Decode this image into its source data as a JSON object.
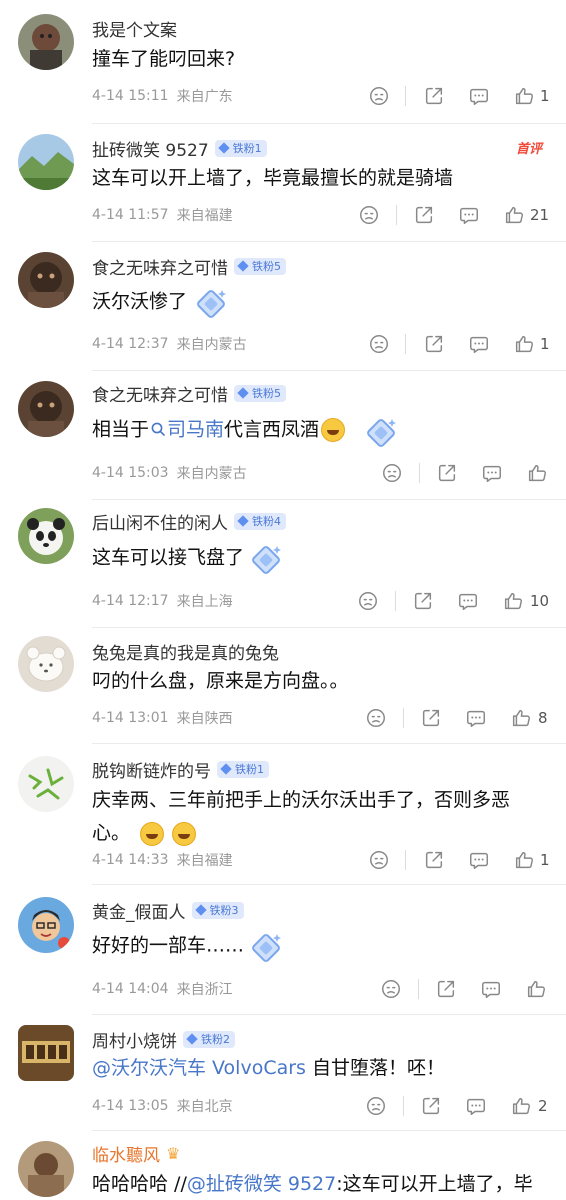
{
  "comments": [
    {
      "user": "我是个文案",
      "text": "撞车了能叼回来?",
      "time": "4-14 15:11",
      "location": "来自广东",
      "likes": "1"
    },
    {
      "user": "扯砖微笑 9527",
      "badge": "铁粉1",
      "hot": "首评",
      "text": "这车可以开上墙了，毕竟最擅长的就是骑墙",
      "time": "4-14 11:57",
      "location": "来自福建",
      "likes": "21"
    },
    {
      "user": "食之无味弃之可惜",
      "badge": "铁粉5",
      "text": "沃尔沃惨了",
      "time": "4-14 12:37",
      "location": "来自内蒙古",
      "likes": "1"
    },
    {
      "user": "食之无味弃之可惜",
      "badge": "铁粉5",
      "text_pre": "相当于",
      "text_link": "司马南",
      "text_post": "代言西凤酒",
      "time": "4-14 15:03",
      "location": "来自内蒙古",
      "likes": ""
    },
    {
      "user": "后山闲不住的闲人",
      "badge": "铁粉4",
      "text": "这车可以接飞盘了",
      "time": "4-14 12:17",
      "location": "来自上海",
      "likes": "10"
    },
    {
      "user": "兔兔是真的我是真的兔兔",
      "text": "叼的什么盘，原来是方向盘。。",
      "time": "4-14 13:01",
      "location": "来自陕西",
      "likes": "8"
    },
    {
      "user": "脱钩断链炸的号",
      "badge": "铁粉1",
      "text_line1": "庆幸两、三年前把手上的沃尔沃出手了，否则多恶",
      "text_line2": "心。",
      "time": "4-14 14:33",
      "location": "来自福建",
      "likes": "1"
    },
    {
      "user": "黄金_假面人",
      "badge": "铁粉3",
      "text": "好好的一部车……",
      "time": "4-14 14:04",
      "location": "来自浙江",
      "likes": ""
    },
    {
      "user": "周村小烧饼",
      "badge": "铁粉2",
      "text_link": "@沃尔沃汽车 VolvoCars",
      "text_post": " 自甘堕落！呸！",
      "time": "4-14 13:05",
      "location": "来自北京",
      "likes": "2"
    },
    {
      "user": "临水聽风",
      "text_pre": "哈哈哈哈 //",
      "text_link": "@扯砖微笑 9527",
      "text_post": ":这车可以开上墙了，毕"
    }
  ],
  "icons": {
    "dislike": "dislike-icon",
    "share": "share-icon",
    "comment": "comment-icon",
    "like": "like-icon",
    "search": "search-icon",
    "badge": "fan-badge-icon",
    "crown": "crown-icon",
    "sticker": "diamond-sticker-icon"
  },
  "colors": {
    "link": "#4877c9",
    "badge_bg": "#dfe9fb",
    "badge_text": "#4a78d6",
    "hot": "#f04a3a",
    "username_vip": "#e8762d"
  }
}
